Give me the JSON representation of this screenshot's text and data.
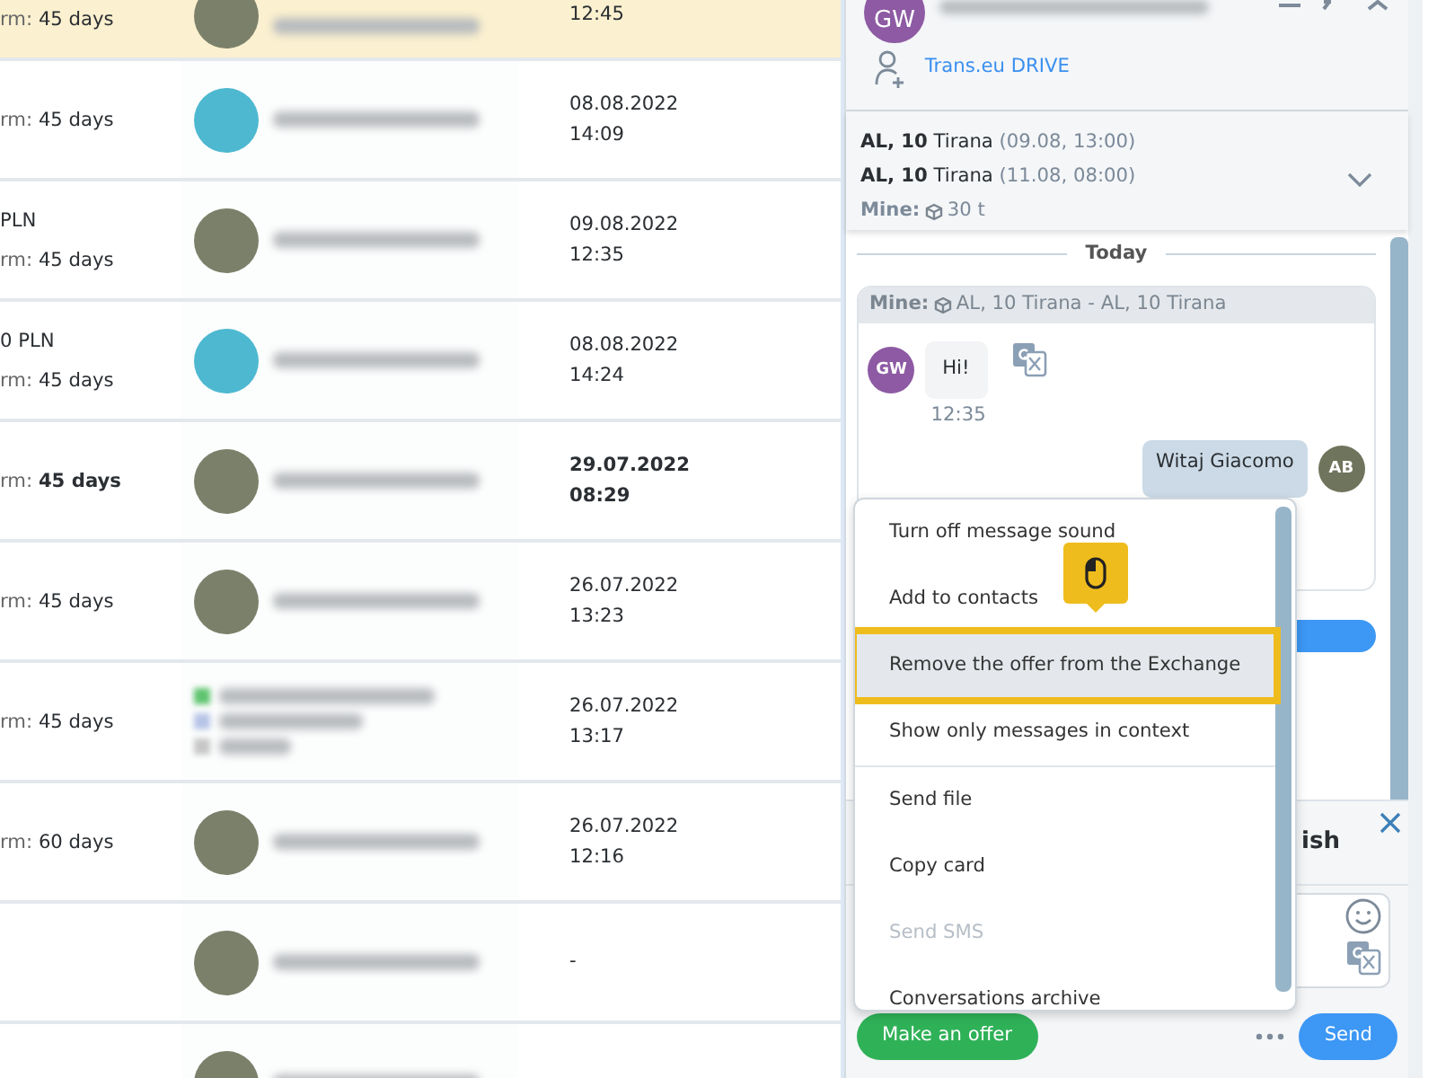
{
  "offers_table": {
    "rows": [
      {
        "highlighted": true,
        "bold": false,
        "price": "",
        "term_label": "rm:",
        "term": "45 days",
        "color": "#7b806a",
        "kind": "single",
        "date": "",
        "time": "12:45"
      },
      {
        "highlighted": false,
        "bold": false,
        "price": "",
        "term_label": "rm:",
        "term": "45 days",
        "color": "#4db8d0",
        "kind": "single",
        "date": "08.08.2022",
        "time": "14:09"
      },
      {
        "highlighted": false,
        "bold": false,
        "price": "PLN",
        "term_label": "rm:",
        "term": "45 days",
        "color": "#7b806a",
        "kind": "single",
        "date": "09.08.2022",
        "time": "12:35"
      },
      {
        "highlighted": false,
        "bold": false,
        "price": "0 PLN",
        "term_label": "rm:",
        "term": "45 days",
        "color": "#4db8d0",
        "kind": "single",
        "date": "08.08.2022",
        "time": "14:24"
      },
      {
        "highlighted": false,
        "bold": true,
        "price": "",
        "term_label": "rm:",
        "term": "45 days",
        "color": "#7b806a",
        "kind": "single",
        "date": "29.07.2022",
        "time": "08:29"
      },
      {
        "highlighted": false,
        "bold": false,
        "price": "",
        "term_label": "rm:",
        "term": "45 days",
        "color": "#7b806a",
        "kind": "single",
        "date": "26.07.2022",
        "time": "13:23"
      },
      {
        "highlighted": false,
        "bold": false,
        "price": "",
        "term_label": "rm:",
        "term": "45 days",
        "kind": "multi",
        "date": "26.07.2022",
        "time": "13:17"
      },
      {
        "highlighted": false,
        "bold": false,
        "price": "",
        "term_label": "rm:",
        "term": "60 days",
        "color": "#7b806a",
        "kind": "single",
        "date": "26.07.2022",
        "time": "12:16"
      },
      {
        "highlighted": false,
        "bold": false,
        "price": "",
        "term_label": "",
        "term": "",
        "color": "#7b806a",
        "kind": "single",
        "date": "-",
        "time": ""
      },
      {
        "highlighted": false,
        "price": "",
        "term_label": "",
        "term": "",
        "color": "#7b806a",
        "kind": "single",
        "date": "",
        "time": ""
      }
    ]
  },
  "chat": {
    "header": {
      "avatar": "GW",
      "link": "Trans.eu DRIVE"
    },
    "route": {
      "lines": [
        {
          "place": "AL, 10",
          "city": "Tirana",
          "when": "(09.08, 13:00)"
        },
        {
          "place": "AL, 10",
          "city": "Tirana",
          "when": "(11.08, 08:00)"
        }
      ],
      "mine_label": "Mine:",
      "mine_value": "30 t"
    },
    "day_divider": "Today",
    "context_card": {
      "label": "Mine:",
      "route": "AL, 10 Tirana - AL, 10 Tirana"
    },
    "messages": [
      {
        "kind": "incoming",
        "avatar": "GW",
        "text": "Hi!",
        "time": "12:35"
      },
      {
        "kind": "outgoing",
        "avatar": "AB",
        "text": "Witaj Giacomo"
      }
    ],
    "translation_banner": {
      "text": "ish"
    },
    "buttons": {
      "offer": "Make an offer",
      "send": "Send"
    }
  },
  "context_menu": {
    "items": [
      {
        "label": "Turn off message sound",
        "selected": false,
        "disabled": false,
        "separator_after": false
      },
      {
        "label": "Add to contacts",
        "selected": false,
        "disabled": false,
        "separator_after": false
      },
      {
        "label": "Remove the offer from the Exchange",
        "selected": true,
        "disabled": false,
        "separator_after": false
      },
      {
        "label": "Show only messages in context",
        "selected": false,
        "disabled": false,
        "separator_after": true
      },
      {
        "label": "Send file",
        "selected": false,
        "disabled": false,
        "separator_after": false
      },
      {
        "label": "Copy card",
        "selected": false,
        "disabled": false,
        "separator_after": false
      },
      {
        "label": "Send SMS",
        "selected": false,
        "disabled": true,
        "separator_after": false
      },
      {
        "label": "Conversations archive",
        "selected": false,
        "disabled": false,
        "separator_after": false
      }
    ]
  }
}
